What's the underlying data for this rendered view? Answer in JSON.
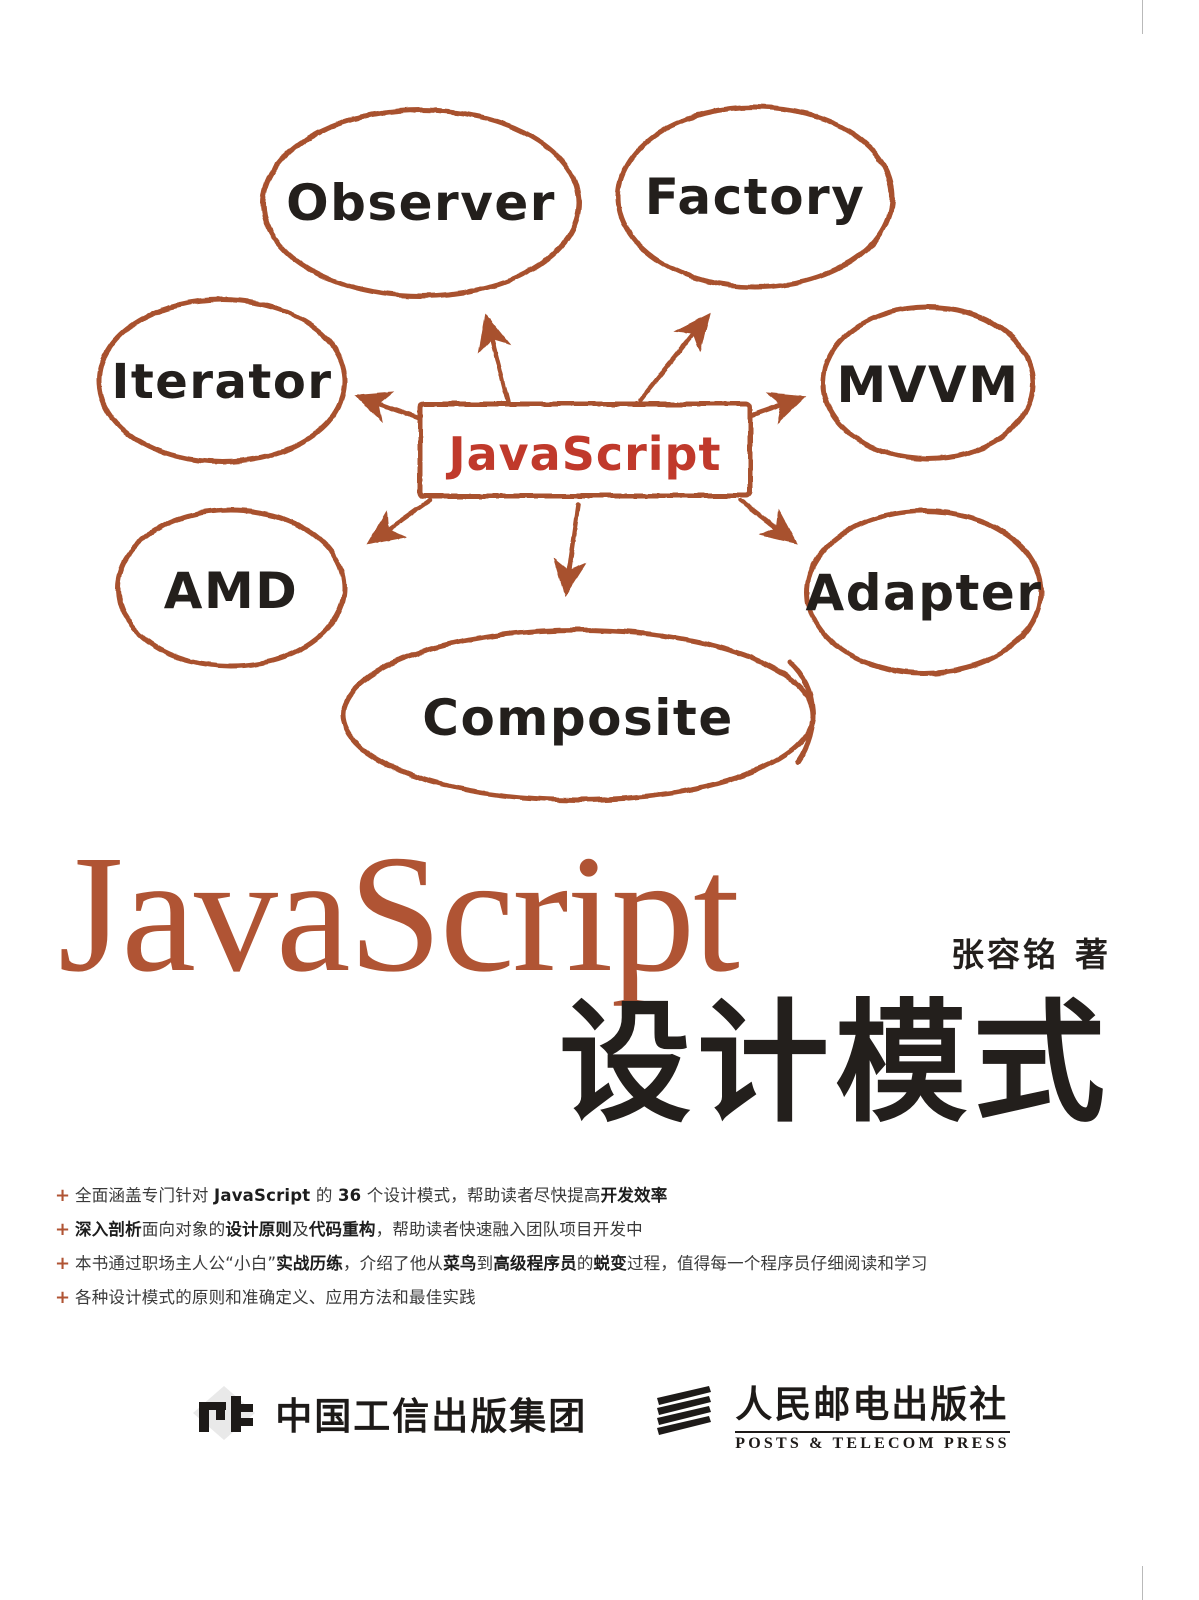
{
  "book": {
    "main_title": "JavaScript",
    "subtitle": "设计模式",
    "author": "张容铭",
    "author_suffix": "著"
  },
  "colors": {
    "accent_brown": "#b05434",
    "node_stroke": "#a8512f",
    "center_text_red": "#c0392b",
    "ink": "#231f1c"
  },
  "diagram": {
    "center": {
      "label": "JavaScript",
      "shape": "rectangle"
    },
    "nodes": [
      {
        "label": "Observer",
        "shape": "ellipse"
      },
      {
        "label": "Factory",
        "shape": "ellipse"
      },
      {
        "label": "Iterator",
        "shape": "ellipse"
      },
      {
        "label": "MVVM",
        "shape": "ellipse"
      },
      {
        "label": "AMD",
        "shape": "ellipse"
      },
      {
        "label": "Adapter",
        "shape": "ellipse"
      },
      {
        "label": "Composite",
        "shape": "ellipse"
      }
    ]
  },
  "bullets": [
    {
      "marker": "+",
      "segments": [
        {
          "text": "全面涵盖专门针对 ",
          "bold": false
        },
        {
          "text": "JavaScript",
          "bold": true
        },
        {
          "text": " 的 ",
          "bold": false
        },
        {
          "text": "36",
          "bold": true
        },
        {
          "text": " 个设计模式，帮助读者尽快提高",
          "bold": false
        },
        {
          "text": "开发效率",
          "bold": true
        }
      ]
    },
    {
      "marker": "+",
      "segments": [
        {
          "text": "深入剖析",
          "bold": true
        },
        {
          "text": "面向对象的",
          "bold": false
        },
        {
          "text": "设计原则",
          "bold": true
        },
        {
          "text": "及",
          "bold": false
        },
        {
          "text": "代码重构",
          "bold": true
        },
        {
          "text": "，帮助读者快速融入团队项目开发中",
          "bold": false
        }
      ]
    },
    {
      "marker": "+",
      "segments": [
        {
          "text": "本书通过职场主人公“小白”",
          "bold": false
        },
        {
          "text": "实战历练",
          "bold": true
        },
        {
          "text": "，介绍了他从",
          "bold": false
        },
        {
          "text": "菜鸟",
          "bold": true
        },
        {
          "text": "到",
          "bold": false
        },
        {
          "text": "高级程序员",
          "bold": true
        },
        {
          "text": "的",
          "bold": false
        },
        {
          "text": "蜕变",
          "bold": true
        },
        {
          "text": "过程，值得每一个程序员仔细阅读和学习",
          "bold": false
        }
      ]
    },
    {
      "marker": "+",
      "segments": [
        {
          "text": "各种设计模式的原则和准确定义、应用方法和最佳实践",
          "bold": false
        }
      ]
    }
  ],
  "publishers": [
    {
      "name": "中国工信出版集团",
      "sub": "",
      "mark": "china-publishing-group-logo"
    },
    {
      "name": "人民邮电出版社",
      "sub": "POSTS & TELECOM PRESS",
      "mark": "ptpress-logo"
    }
  ]
}
